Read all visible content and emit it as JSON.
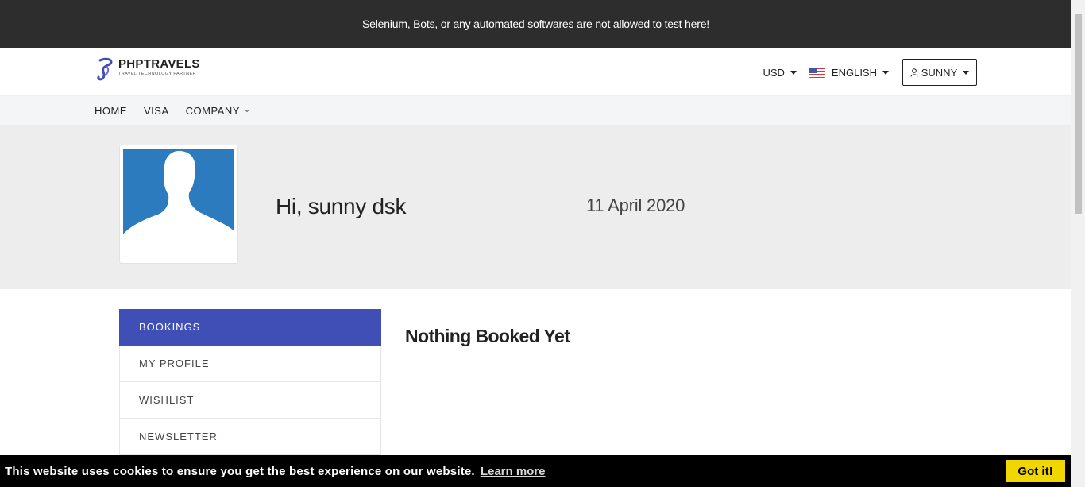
{
  "banner": {
    "text": "Selenium, Bots, or any automated softwares are not allowed to test here!"
  },
  "header": {
    "logo_name": "PHPTRAVELS",
    "logo_tagline": "TRAVEL TECHNOLOGY PARTNER",
    "currency": "USD",
    "language": "ENGLISH",
    "user": "SUNNY"
  },
  "nav": {
    "items": [
      {
        "label": "HOME"
      },
      {
        "label": "VISA"
      },
      {
        "label": "COMPANY"
      }
    ]
  },
  "profile": {
    "greeting": "Hi, sunny dsk",
    "date": "11 April 2020"
  },
  "sidebar": {
    "items": [
      {
        "label": "BOOKINGS"
      },
      {
        "label": "MY PROFILE"
      },
      {
        "label": "WISHLIST"
      },
      {
        "label": "NEWSLETTER"
      }
    ]
  },
  "main": {
    "title": "Nothing Booked Yet"
  },
  "cookie": {
    "message": "This website uses cookies to ensure you get the best experience on our website.",
    "learn_more": "Learn more",
    "button": "Got it!"
  },
  "colors": {
    "accent": "#3f4fb5",
    "banner_bg": "#2d2d2d",
    "cookie_button": "#f1d600",
    "avatar_bg": "#2c7bbf"
  },
  "icons": {
    "logo": "phptravels-logo-icon",
    "flag": "us-flag-icon",
    "user": "user-icon",
    "chevron": "chevron-down-icon",
    "avatar": "person-silhouette-icon"
  }
}
